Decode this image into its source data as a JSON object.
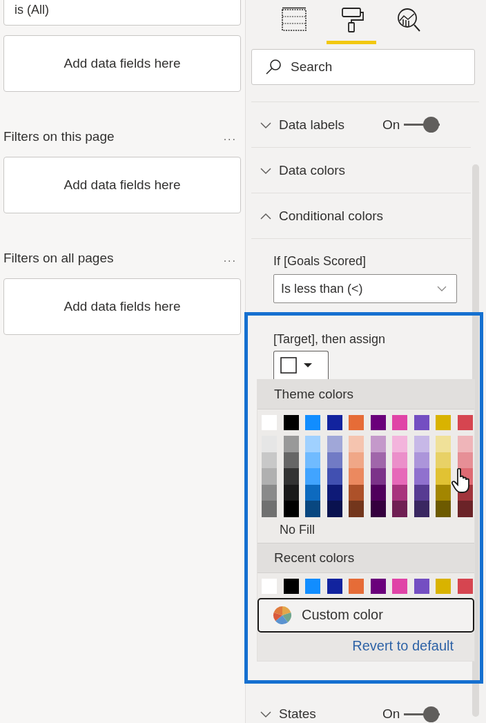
{
  "filters": {
    "top_card": {
      "value": "is (All)",
      "drop": "Add data fields here"
    },
    "sections": [
      {
        "title": "Filters on this page",
        "more": "...",
        "drop": "Add data fields here"
      },
      {
        "title": "Filters on all pages",
        "more": "...",
        "drop": "Add data fields here"
      }
    ]
  },
  "format_pane": {
    "tabs": [
      {
        "kind": "fields",
        "selected": false
      },
      {
        "kind": "format",
        "selected": true
      },
      {
        "kind": "analytics",
        "selected": false
      }
    ],
    "search": {
      "placeholder": "Search"
    },
    "sections": [
      {
        "label": "Data labels",
        "expanded": false,
        "toggle": {
          "label": "On",
          "on": true
        }
      },
      {
        "label": "Data colors",
        "expanded": false
      },
      {
        "label": "Conditional colors",
        "expanded": true
      }
    ],
    "condition": {
      "label": "If [Goals Scored]",
      "dropdown": "Is less than (<)",
      "then_label": "[Target], then assign"
    },
    "color_picker": {
      "theme_header": "Theme colors",
      "theme_colors": [
        {
          "color": "#ffffff",
          "shades": [
            {
              "color": "#e6e6e6"
            },
            {
              "color": "#c8c8c8"
            },
            {
              "color": "#b0b0b0"
            },
            {
              "color": "#8a8a8a"
            },
            {
              "color": "#707070"
            }
          ]
        },
        {
          "color": "#000000",
          "shades": [
            {
              "color": "#999999"
            },
            {
              "color": "#666666"
            },
            {
              "color": "#333333"
            },
            {
              "color": "#1a1a1a"
            },
            {
              "color": "#000000"
            }
          ]
        },
        {
          "color": "#118dff",
          "shades": [
            {
              "color": "#a0d1ff"
            },
            {
              "color": "#70bbff"
            },
            {
              "color": "#41a4ff"
            },
            {
              "color": "#0d6abf"
            },
            {
              "color": "#094780"
            }
          ]
        },
        {
          "color": "#12239e",
          "shades": [
            {
              "color": "#a0a7d8"
            },
            {
              "color": "#717bc5"
            },
            {
              "color": "#4150b1"
            },
            {
              "color": "#0e1a77"
            },
            {
              "color": "#09124f"
            }
          ]
        },
        {
          "color": "#e66c37",
          "shades": [
            {
              "color": "#f5c4af"
            },
            {
              "color": "#f0a787"
            },
            {
              "color": "#eb895f"
            },
            {
              "color": "#ad5129"
            },
            {
              "color": "#73361c"
            }
          ]
        },
        {
          "color": "#6b007b",
          "shades": [
            {
              "color": "#c499ca"
            },
            {
              "color": "#a066aa"
            },
            {
              "color": "#7c3389"
            },
            {
              "color": "#50005c"
            },
            {
              "color": "#35003e"
            }
          ]
        },
        {
          "color": "#e044a7",
          "shades": [
            {
              "color": "#f3b4dc"
            },
            {
              "color": "#eb8fca"
            },
            {
              "color": "#e669b9"
            },
            {
              "color": "#a8337d"
            },
            {
              "color": "#701f53"
            }
          ]
        },
        {
          "color": "#744ec2",
          "shades": [
            {
              "color": "#c7b8e7"
            },
            {
              "color": "#ac95da"
            },
            {
              "color": "#9071ce"
            },
            {
              "color": "#573b92"
            },
            {
              "color": "#3a2761"
            }
          ]
        },
        {
          "color": "#d9b300",
          "shades": [
            {
              "color": "#f0e199"
            },
            {
              "color": "#e8d166"
            },
            {
              "color": "#e1c233"
            },
            {
              "color": "#a38600"
            },
            {
              "color": "#6d5a00"
            }
          ]
        },
        {
          "color": "#d64550",
          "shades": [
            {
              "color": "#efb5b9"
            },
            {
              "color": "#e68f96"
            },
            {
              "color": "#de6a73"
            },
            {
              "color": "#a1343c"
            },
            {
              "color": "#6b2328"
            }
          ]
        }
      ],
      "no_fill": "No Fill",
      "recent_header": "Recent colors",
      "recent_colors": [
        {
          "color": "#ffffff"
        },
        {
          "color": "#000000"
        },
        {
          "color": "#118dff"
        },
        {
          "color": "#12239e"
        },
        {
          "color": "#e66c37"
        },
        {
          "color": "#6b007b"
        },
        {
          "color": "#e044a7"
        },
        {
          "color": "#744ec2"
        },
        {
          "color": "#d9b300"
        },
        {
          "color": "#d64550"
        }
      ],
      "custom_button": "Custom color",
      "revert_link": "Revert to default"
    },
    "bottom_section": {
      "label": "States",
      "expanded": false,
      "toggle": {
        "label": "On",
        "on": true
      }
    }
  }
}
